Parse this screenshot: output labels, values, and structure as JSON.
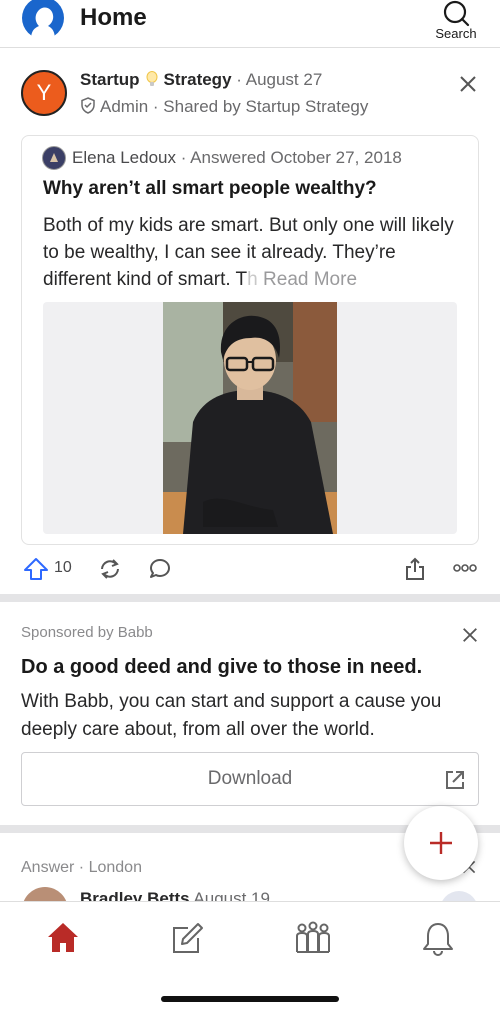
{
  "header": {
    "title": "Home",
    "search_label": "Search",
    "accent": "#1a66cc"
  },
  "card1": {
    "space_avatar_letter": "Y",
    "space_name_part1": "Startup",
    "space_name_part2": "Strategy",
    "space_sep": "·",
    "space_date": "August 27",
    "role": "Admin",
    "shared_by": "· Shared by Startup Strategy",
    "answer": {
      "author": "Elena Ledoux",
      "answered": "· Answered October 27, 2018",
      "question": "Why aren’t all smart people wealthy?",
      "excerpt": "Both of my kids are smart. But only one will likely to be wealthy, I can see it already. They’re different kind of smart. T",
      "excerpt_fade": "h",
      "read_more": "Read More"
    },
    "upvotes": "10",
    "upvote_color": "#2e69ff"
  },
  "sponsored": {
    "label": "Sponsored by Babb",
    "title": "Do a good deed and give to those in need.",
    "body": "With Babb, you can start and support a cause you deeply care about, from all over the world.",
    "button": "Download"
  },
  "card3": {
    "meta": "Answer · London",
    "author": "Bradley Betts",
    "date": "August 19"
  },
  "fab_color": "#b92b27",
  "nav": {
    "active_color": "#b92b27",
    "items": [
      "home-icon",
      "compose-icon",
      "spaces-icon",
      "bell-icon"
    ]
  }
}
